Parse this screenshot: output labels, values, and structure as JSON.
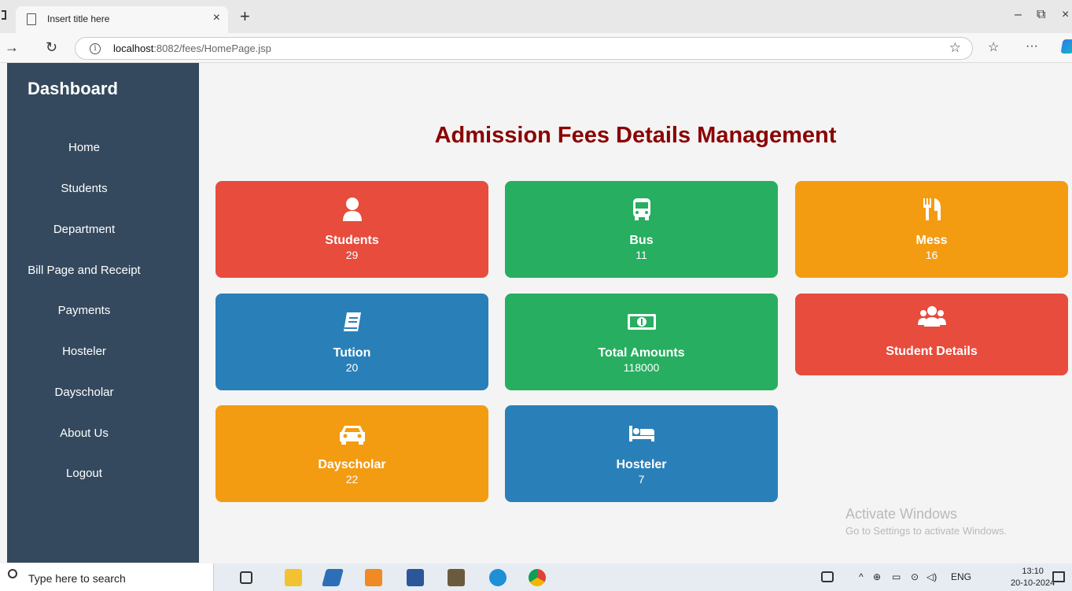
{
  "browser": {
    "tab_title": "Insert title here",
    "tab_close": "×",
    "new_tab": "+",
    "url_host": "localhost",
    "url_path": ":8082/fees/HomePage.jsp",
    "win_min": "–",
    "win_restore": "⧉",
    "win_close": "×",
    "more": "···"
  },
  "sidebar": {
    "title": "Dashboard",
    "items": [
      {
        "label": "Home"
      },
      {
        "label": "Students"
      },
      {
        "label": "Department"
      },
      {
        "label": "Bill Page and Receipt"
      },
      {
        "label": "Payments"
      },
      {
        "label": "Hosteler"
      },
      {
        "label": "Dayscholar"
      },
      {
        "label": "About Us"
      },
      {
        "label": "Logout"
      }
    ]
  },
  "main": {
    "title": "Admission Fees Details Management",
    "cards": [
      {
        "label": "Students",
        "count": "29",
        "icon": "user-icon",
        "color": "#e74c3c"
      },
      {
        "label": "Bus",
        "count": "11",
        "icon": "bus-icon",
        "color": "#27ae60"
      },
      {
        "label": "Mess",
        "count": "16",
        "icon": "utensils-icon",
        "color": "#f39c12"
      },
      {
        "label": "Tution",
        "count": "20",
        "icon": "book-icon",
        "color": "#2980b9"
      },
      {
        "label": "Total Amounts",
        "count": "118000",
        "icon": "money-bill-icon",
        "color": "#27ae60"
      },
      {
        "label": "Student Details",
        "icon": "users-icon",
        "color": "#e74c3c"
      },
      {
        "label": "Dayscholar",
        "count": "22",
        "icon": "car-icon",
        "color": "#f39c12"
      },
      {
        "label": "Hosteler",
        "count": "7",
        "icon": "bed-icon",
        "color": "#2980b9"
      }
    ]
  },
  "watermark": {
    "line1": "Activate Windows",
    "line2": "Go to Settings to activate Windows."
  },
  "taskbar": {
    "search_placeholder": "Type here to search",
    "lang": "ENG",
    "time": "13:10",
    "date": "20-10-2024"
  }
}
